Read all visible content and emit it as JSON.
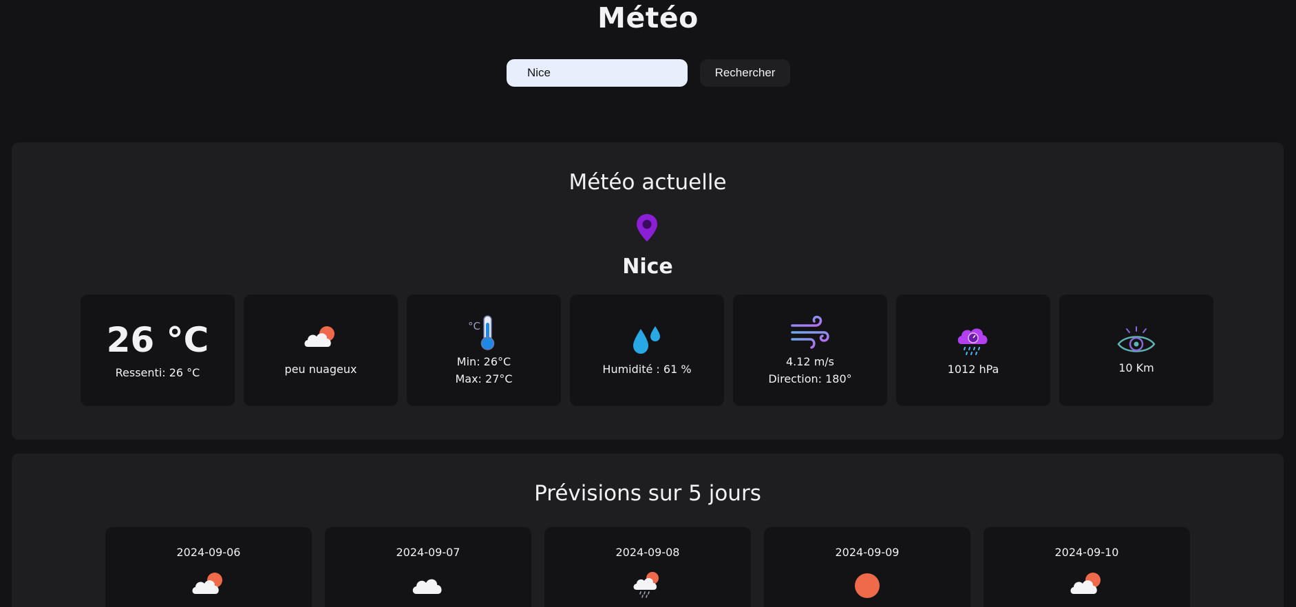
{
  "app": {
    "title": "Météo"
  },
  "search": {
    "value": "Nice",
    "button_label": "Rechercher"
  },
  "current": {
    "section_title": "Météo actuelle",
    "city": "Nice",
    "temperature": "26 °C",
    "feels_like": "Ressenti: 26 °C",
    "description": "peu nuageux",
    "min": "Min: 26°C",
    "max": "Max: 27°C",
    "humidity": "Humidité : 61 %",
    "wind_speed": "4.12 m/s",
    "wind_direction": "Direction: 180°",
    "pressure": "1012 hPa",
    "visibility": "10 Km",
    "icons": [
      "location-pin-icon",
      "cloud-sun-icon",
      "thermometer-icon",
      "water-drops-icon",
      "wind-icon",
      "storm-cloud-icon",
      "eye-icon"
    ]
  },
  "forecast": {
    "section_title": "Prévisions sur 5 jours",
    "days": [
      {
        "date": "2024-09-06",
        "icon": "cloud-sun-icon"
      },
      {
        "date": "2024-09-07",
        "icon": "cloud-icon"
      },
      {
        "date": "2024-09-08",
        "icon": "rain-cloud-sun-icon"
      },
      {
        "date": "2024-09-09",
        "icon": "sun-icon"
      },
      {
        "date": "2024-09-10",
        "icon": "cloud-sun-icon"
      }
    ]
  },
  "colors": {
    "background": "#131315",
    "panel": "#1e1e21",
    "card": "#131315",
    "accent_purple": "#8a1fd6",
    "sun_orange": "#ee6a4a",
    "input_bg": "#e8eefc"
  }
}
